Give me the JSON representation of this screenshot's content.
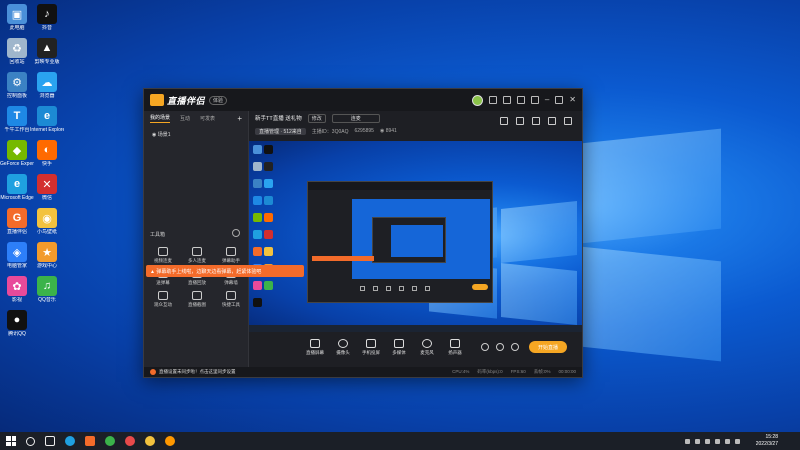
{
  "desktop": {
    "icons": [
      {
        "label": "此电脑",
        "color": "#4a90d9",
        "glyph": "▣"
      },
      {
        "label": "回收站",
        "color": "#9fb6cc",
        "glyph": "♻"
      },
      {
        "label": "控制面板",
        "color": "#3b82c4",
        "glyph": "⚙"
      },
      {
        "label": "千牛工作台",
        "color": "#1e88e5",
        "glyph": "T"
      },
      {
        "label": "GeForce Experience",
        "color": "#76b900",
        "glyph": "◆"
      },
      {
        "label": "Microsoft Edge",
        "color": "#1fa0e0",
        "glyph": "e"
      },
      {
        "label": "直播伴侣",
        "color": "#f36b2a",
        "glyph": "G"
      },
      {
        "label": "电脑管家",
        "color": "#2d7ff9",
        "glyph": "◈"
      },
      {
        "label": "影视",
        "color": "#e84a9a",
        "glyph": "✿"
      },
      {
        "label": "腾讯QQ",
        "color": "#111111",
        "glyph": "●"
      },
      {
        "label": "抖音",
        "color": "#111111",
        "glyph": "♪"
      },
      {
        "label": "剪映专业版",
        "color": "#222222",
        "glyph": "▲"
      },
      {
        "label": "浏览器",
        "color": "#2aa3f0",
        "glyph": "☁"
      },
      {
        "label": "Internet Explorer",
        "color": "#1c8ad4",
        "glyph": "e"
      },
      {
        "label": "快手",
        "color": "#ff6a00",
        "glyph": "◐"
      },
      {
        "label": "微信",
        "color": "#d32f2f",
        "glyph": "✕"
      },
      {
        "label": "小鸟壁纸",
        "color": "#f3c23e",
        "glyph": "◉"
      },
      {
        "label": "游戏中心",
        "color": "#f29b2c",
        "glyph": "★"
      },
      {
        "label": "QQ音乐",
        "color": "#3bb34a",
        "glyph": "♫"
      }
    ]
  },
  "app": {
    "brand": "直播伴侣",
    "version": "体验",
    "left_tabs": [
      "我的场景",
      "互动",
      "可发表"
    ],
    "scene_item": "◉ 场景1",
    "tools_title": "工具箱",
    "tools": [
      {
        "label": "视频连麦",
        "color": "#cccccc"
      },
      {
        "label": "多人连麦",
        "color": "#cccccc"
      },
      {
        "label": "弹幕助手",
        "color": "#cccccc"
      },
      {
        "label": "送弹幕",
        "color": "#cccccc"
      },
      {
        "label": "直播回放",
        "color": "#cccccc"
      },
      {
        "label": "弹幕墙",
        "color": "#cccccc"
      },
      {
        "label": "观众互动",
        "color": "#cccccc"
      },
      {
        "label": "直播截图",
        "color": "#cccccc"
      },
      {
        "label": "快捷工具",
        "color": "#cccccc"
      }
    ],
    "banner": "▲ 弹幕助手上线啦，边聊天边看弹幕，赶紧体验吧",
    "room": {
      "title": "新手TT直播 送礼物",
      "tag": "修改",
      "name_box": "连麦",
      "sub_pill": "直播管理 · 512来自",
      "sub_a": "主播ID：3Q0AQ",
      "sub_b": "6295895",
      "sub_c": "◉ 8941"
    },
    "controls": [
      {
        "label": "直播屏幕"
      },
      {
        "label": "摄像头"
      },
      {
        "label": "手机投屏"
      },
      {
        "label": "多媒体"
      },
      {
        "label": "麦克风"
      },
      {
        "label": "扬声器"
      }
    ],
    "start_button": "开始直播",
    "status": {
      "message": "直播设置未同步啦！点击这里同步设置",
      "cpu": "CPU:4%",
      "bitrate": "码率(kbps):0",
      "fps": "FPS:60",
      "drop": "丢帧:0%",
      "time": "00:00:00"
    }
  },
  "taskbar": {
    "time": "15:28",
    "date": "2022/3/27"
  }
}
